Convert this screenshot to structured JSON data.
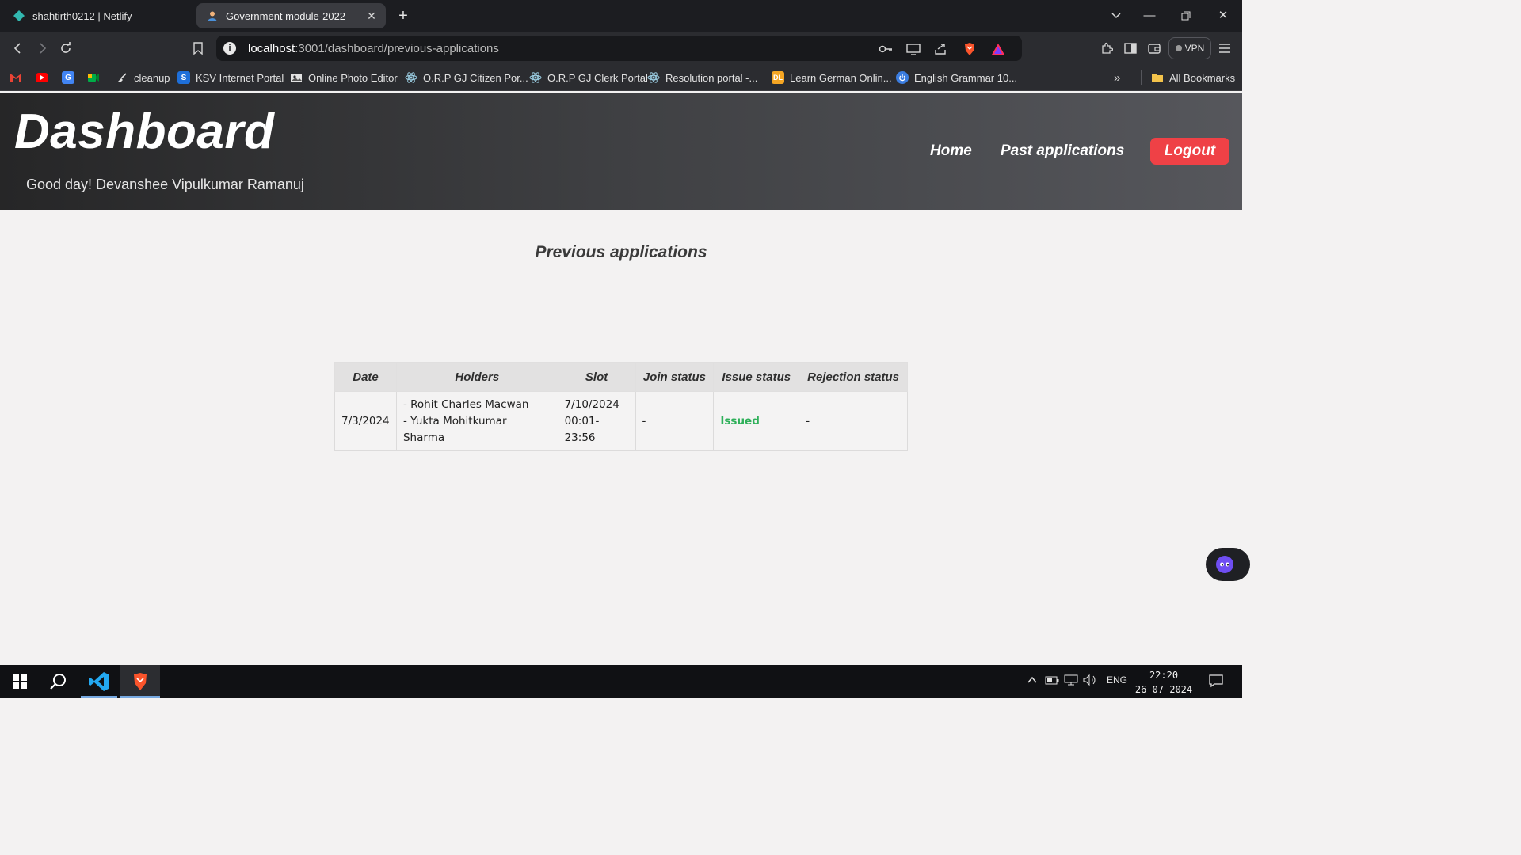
{
  "browser": {
    "tabs": [
      {
        "title": "shahtirth0212 | Netlify",
        "icon": "netlify-icon",
        "active": false
      },
      {
        "title": "Government module-2022",
        "icon": "user-icon",
        "active": true
      }
    ],
    "url_host": "localhost",
    "url_rest": ":3001/dashboard/previous-applications",
    "vpn_label": "VPN",
    "bookmarks": [
      {
        "label": "",
        "icon": "gmail-icon"
      },
      {
        "label": "",
        "icon": "youtube-icon"
      },
      {
        "label": "",
        "icon": "translate-icon"
      },
      {
        "label": "",
        "icon": "meet-icon"
      },
      {
        "label": "cleanup",
        "icon": "broom-icon"
      },
      {
        "label": "KSV Internet Portal",
        "icon": "ksv-icon"
      },
      {
        "label": "Online Photo Editor",
        "icon": "photo-icon"
      },
      {
        "label": "O.R.P GJ Citizen Por...",
        "icon": "react-icon"
      },
      {
        "label": "O.R.P GJ Clerk Portal",
        "icon": "react-icon"
      },
      {
        "label": "Resolution portal -...",
        "icon": "react-icon"
      },
      {
        "label": "Learn German Onlin...",
        "icon": "dl-icon"
      },
      {
        "label": "English Grammar 10...",
        "icon": "power-icon"
      }
    ],
    "all_bookmarks_label": "All Bookmarks"
  },
  "header": {
    "brand": "Dashboard",
    "greeting": "Good day! Devanshee Vipulkumar Ramanuj",
    "nav": {
      "home": "Home",
      "past": "Past applications",
      "logout": "Logout"
    }
  },
  "main": {
    "title": "Previous applications",
    "columns": [
      "Date",
      "Holders",
      "Slot",
      "Join status",
      "Issue status",
      "Rejection status"
    ],
    "rows": [
      {
        "date": "7/3/2024",
        "holders": [
          "- Rohit Charles Macwan",
          "- Yukta Mohitkumar Sharma"
        ],
        "slot_date": "7/10/2024",
        "slot_time": "00:01-23:56",
        "join_status": "-",
        "issue_status": "Issued",
        "rejection_status": "-"
      }
    ]
  },
  "taskbar": {
    "language": "ENG",
    "time": "22:20",
    "date": "26-07-2024"
  },
  "colors": {
    "logout_bg": "#ef4146",
    "issued": "#2fb05a",
    "header_dark": "#262627"
  }
}
